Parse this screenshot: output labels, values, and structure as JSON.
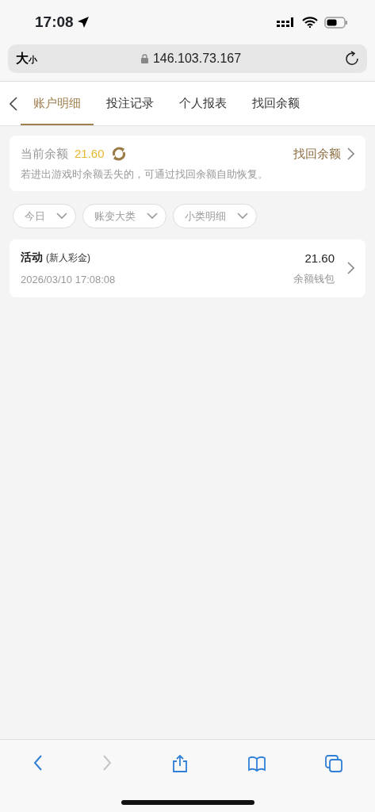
{
  "status_bar": {
    "time": "17:08"
  },
  "browser": {
    "text_size": {
      "large": "大",
      "small": "小"
    },
    "url": "146.103.73.167"
  },
  "tabs": [
    {
      "label": "账户明细",
      "selected": true
    },
    {
      "label": "投注记录",
      "selected": false
    },
    {
      "label": "个人报表",
      "selected": false
    },
    {
      "label": "找回余额",
      "selected": false
    }
  ],
  "balance_card": {
    "label": "当前余额",
    "amount": "21.60",
    "link": "找回余额",
    "hint": "若进出游戏时余额丢失的，可通过找回余额自助恢复。"
  },
  "filters": [
    {
      "label": "今日"
    },
    {
      "label": "账变大类"
    },
    {
      "label": "小类明细"
    }
  ],
  "transactions": [
    {
      "title": "活动",
      "subtitle": "(新人彩金)",
      "date": "2026/03/10 17:08:08",
      "amount": "21.60",
      "wallet": "余额钱包"
    }
  ],
  "toolbar": [
    {
      "kind": "back",
      "disabled": false
    },
    {
      "kind": "forward",
      "disabled": true
    },
    {
      "kind": "share",
      "disabled": false
    },
    {
      "kind": "bookmarks",
      "disabled": false
    },
    {
      "kind": "tabs",
      "disabled": false
    }
  ]
}
